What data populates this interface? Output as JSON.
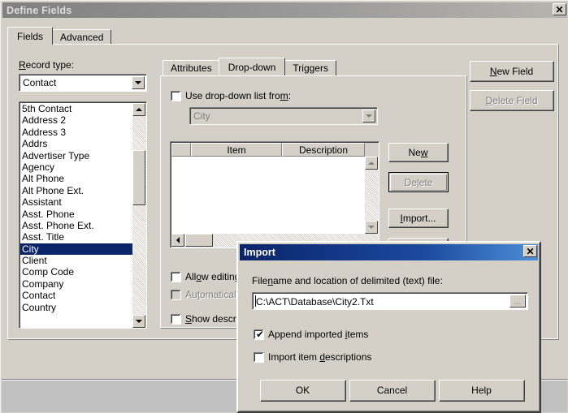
{
  "main_window": {
    "title": "Define Fields",
    "close_icon": "close-icon",
    "tabs": [
      {
        "label": "Fields",
        "active": true
      },
      {
        "label": "Advanced",
        "active": false
      }
    ],
    "record_type": {
      "label_prefix": "R",
      "label_rest": "ecord type:",
      "value": "Contact"
    },
    "field_list": {
      "items": [
        "5th Contact",
        "Address 2",
        "Address 3",
        "Addrs",
        "Advertiser Type",
        "Agency",
        "Alt Phone",
        "Alt Phone Ext.",
        "Assistant",
        "Asst. Phone",
        "Asst. Phone Ext.",
        "Asst. Title",
        "City",
        "Client",
        "Comp Code",
        "Company",
        "Contact",
        "Country"
      ],
      "selected": "City"
    },
    "inner_tabs": [
      {
        "label": "Attributes",
        "active": false
      },
      {
        "label": "Drop-down",
        "active": true
      },
      {
        "label": "Triggers",
        "active": false
      }
    ],
    "use_dropdown": {
      "label_a": "Use drop-down list fro",
      "label_u": "m",
      "label_b": ":",
      "checked": false
    },
    "source_combo": {
      "value": "City",
      "disabled": true
    },
    "grid": {
      "columns": [
        "",
        "Item",
        "Description"
      ],
      "rows": []
    },
    "checkboxes": [
      {
        "pre": "All",
        "key": "o",
        "post": "w editing of drop-down list",
        "checked": false,
        "disabled": false
      },
      {
        "pre": "Au",
        "key": "t",
        "post": "omatically add new items",
        "checked": false,
        "disabled": true
      },
      {
        "pre": "",
        "key": "S",
        "post": "how description in drop-down list",
        "checked": false,
        "disabled": false
      }
    ],
    "buttons": {
      "new_field": {
        "pre": "",
        "key": "N",
        "post": "ew Field",
        "disabled": false
      },
      "delete_field": {
        "pre": "",
        "key": "D",
        "post": "elete Field",
        "disabled": true
      },
      "new": {
        "pre": "Ne",
        "key": "w",
        "post": "",
        "disabled": false
      },
      "delete": {
        "pre": "De",
        "key": "l",
        "post": "ete",
        "disabled": true,
        "focused": true
      },
      "import": {
        "pre": "",
        "key": "I",
        "post": "mport...",
        "disabled": false
      }
    }
  },
  "import_dialog": {
    "title": "Import",
    "close_icon": "close-icon",
    "filename_label": {
      "pre": "File",
      "key": "n",
      "post": "ame and location of delimited (text) file:"
    },
    "filename_value": "C:\\ACT\\Database\\City2.Txt",
    "browse_label": "...",
    "checkboxes": [
      {
        "pre": "Append imported ",
        "key": "i",
        "post": "tems",
        "checked": true
      },
      {
        "pre": "Import item ",
        "key": "d",
        "post": "escriptions",
        "checked": false
      }
    ],
    "buttons": [
      {
        "label": "OK"
      },
      {
        "label": "Cancel"
      },
      {
        "label": "Help"
      }
    ]
  },
  "colors": {
    "face": "#d4d0c8",
    "selection": "#0a246a",
    "title_active_start": "#0a246a",
    "title_inactive": "#808080",
    "disabled_text": "#808080"
  }
}
